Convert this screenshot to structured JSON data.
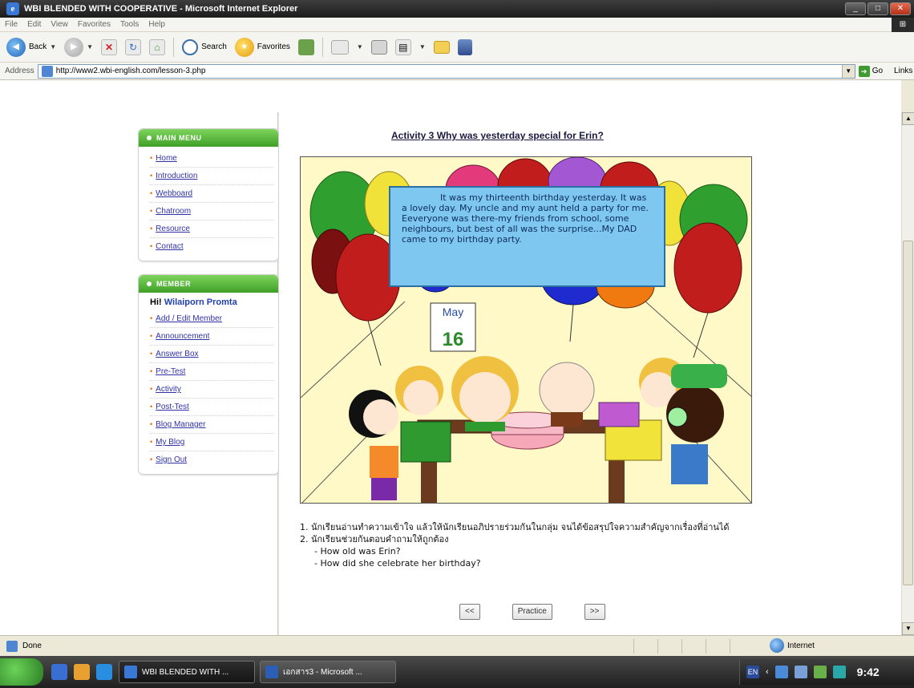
{
  "window": {
    "title": "WBI BLENDED WITH COOPERATIVE - Microsoft Internet Explorer",
    "minimize": "_",
    "maximize": "□",
    "close": "✕"
  },
  "menubar": [
    "File",
    "Edit",
    "View",
    "Favorites",
    "Tools",
    "Help"
  ],
  "toolbar": {
    "back": "Back",
    "search": "Search",
    "favorites": "Favorites"
  },
  "address": {
    "label": "Address",
    "url": "http://www2.wbi-english.com/lesson-3.php",
    "go": "Go",
    "links": "Links"
  },
  "main_menu": {
    "header": "MAIN MENU",
    "items": [
      "Home",
      "Introduction",
      "Webboard",
      "Chatroom",
      "Resource",
      "Contact"
    ]
  },
  "member_menu": {
    "header": "MEMBER",
    "greeting": "Hi!",
    "user": "Wilaiporn Promta",
    "items": [
      "Add / Edit Member",
      "Announcement",
      "Answer Box",
      "Pre-Test",
      "Activity",
      "Post-Test",
      "Blog Manager",
      "My Blog",
      "Sign Out"
    ]
  },
  "activity": {
    "title": "Activity 3 Why was yesterday special for Erin?",
    "story": "It was my thirteenth birthday yesterday. It was a lovely day. My uncle and my aunt held a party for me. Eeveryone was there-my friends from school, some neighbours, but best of all was the surprise...My DAD came to my birthday party.",
    "calendar_month": "May",
    "calendar_day": "16",
    "instruction_1": "1. นักเรียนอ่านทำความเข้าใจ แล้วให้นักเรียนอภิปรายร่วมกันในกลุ่ม จนได้ข้อสรุปใจความสำคัญจากเรื่องที่อ่านได้",
    "instruction_2": "2. นักเรียนช่วยกันตอบคำถามให้ถูกต้อง",
    "question_1": "- How old was Erin?",
    "question_2": "- How did she celebrate her birthday?",
    "prev": "<<",
    "practice": "Practice",
    "next": ">>"
  },
  "status": {
    "text": "Done",
    "zone": "Internet"
  },
  "taskbar": {
    "task_1": "WBI BLENDED WITH ...",
    "task_2": "เอกสาร3 - Microsoft ...",
    "lang": "EN",
    "clock": "9:42"
  },
  "colors": {
    "menu_header_green": "#3f9f27",
    "speech_blue": "#7ec7f1",
    "scene_bg": "#fff9c8",
    "link": "#3232a8"
  }
}
